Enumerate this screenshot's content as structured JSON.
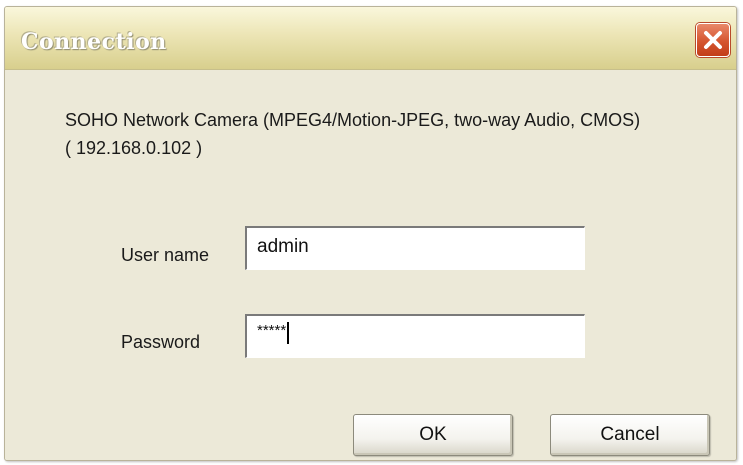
{
  "dialog": {
    "title": "Connection",
    "device_info": "SOHO Network Camera (MPEG4/Motion-JPEG, two-way Audio, CMOS) ( 192.168.0.102 )"
  },
  "form": {
    "username_label": "User name",
    "username_value": "admin",
    "password_label": "Password",
    "password_mask": "*****"
  },
  "buttons": {
    "ok_label": "OK",
    "cancel_label": "Cancel"
  },
  "icons": {
    "close": "close-icon"
  },
  "colors": {
    "close_button": "#d5552f",
    "dialog_background": "#ece9d8"
  }
}
